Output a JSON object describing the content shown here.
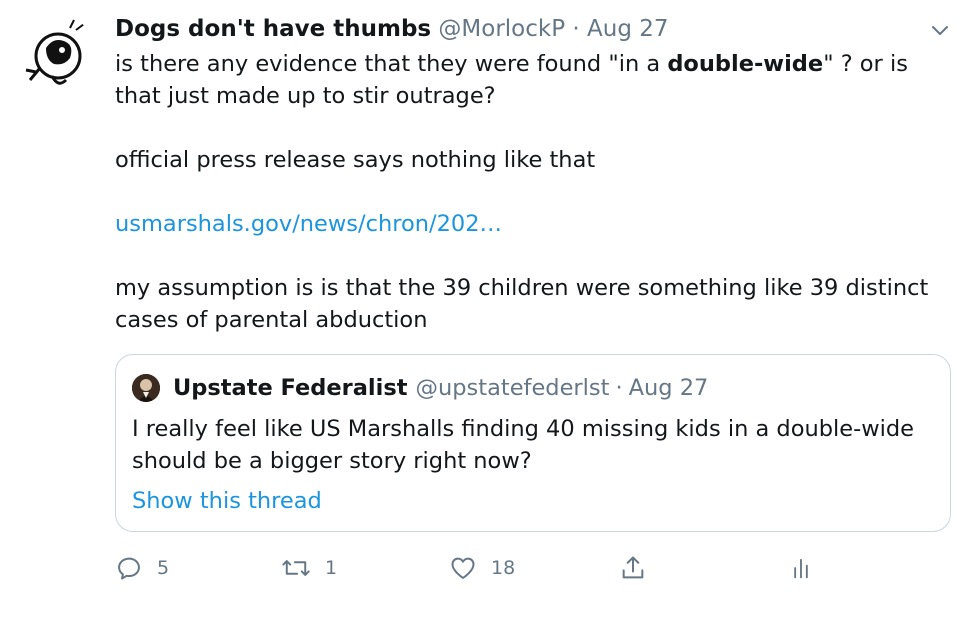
{
  "tweet": {
    "author_name": "Dogs don't have thumbs",
    "handle": "@MorlockP",
    "separator": "·",
    "date": "Aug 27",
    "line1_before": "is there any evidence that they were found \"in a ",
    "line1_bold": "double-wide",
    "line1_after": "\" ?  or is that just made up to stir outrage?",
    "paragraph2": "official press release says nothing like that",
    "link": "usmarshals.gov/news/chron/202…",
    "paragraph4": "my assumption is is that the 39 children were something like 39 distinct cases of parental abduction"
  },
  "quoted": {
    "author_name": "Upstate Federalist",
    "handle": "@upstatefederlst",
    "separator": "·",
    "date": "Aug 27",
    "text": "I really feel like US Marshalls finding 40 missing kids in a double-wide should be a bigger story right now?",
    "thread_link": "Show this thread"
  },
  "actions": {
    "reply_count": "5",
    "retweet_count": "1",
    "like_count": "18"
  },
  "colors": {
    "text": "#14171a",
    "muted": "#657786",
    "link": "#1b95e0",
    "border": "#ccd6dd"
  },
  "icons": [
    "dog-astronaut-avatar",
    "chevron-down-icon",
    "reply-icon",
    "retweet-icon",
    "like-icon",
    "share-icon",
    "analytics-icon"
  ]
}
